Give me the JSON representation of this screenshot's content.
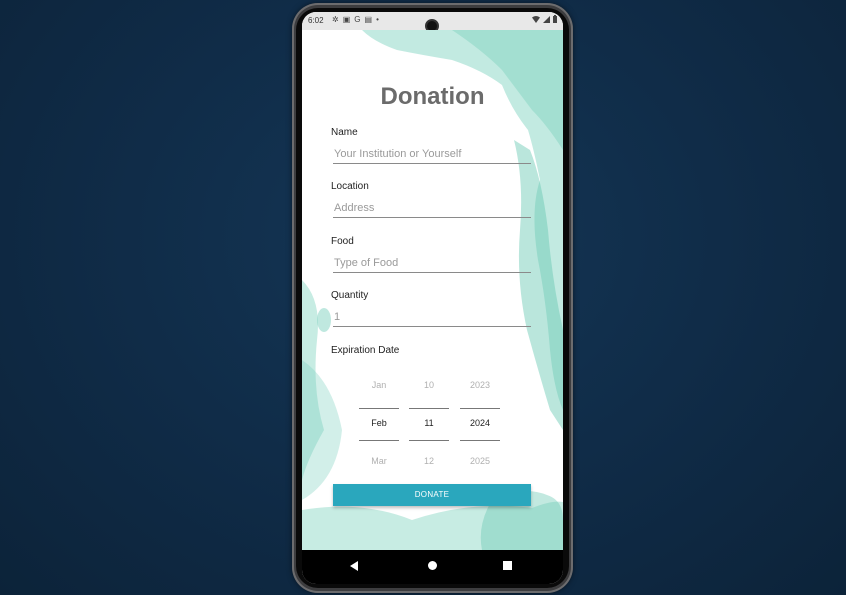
{
  "status_bar": {
    "time": "6:02"
  },
  "form": {
    "title": "Donation",
    "name": {
      "label": "Name",
      "placeholder": "Your Institution or Yourself"
    },
    "location": {
      "label": "Location",
      "placeholder": "Address"
    },
    "food": {
      "label": "Food",
      "placeholder": "Type of Food"
    },
    "quantity": {
      "label": "Quantity",
      "placeholder": "1"
    },
    "expiration": {
      "label": "Expiration Date",
      "month": {
        "prev": "Jan",
        "selected": "Feb",
        "next": "Mar"
      },
      "day": {
        "prev": "10",
        "selected": "11",
        "next": "12"
      },
      "year": {
        "prev": "2023",
        "selected": "2024",
        "next": "2025"
      }
    },
    "submit_label": "DONATE"
  },
  "colors": {
    "accent": "#2aa7bd",
    "wash": "#8fd9c8",
    "background": "#102c49"
  }
}
